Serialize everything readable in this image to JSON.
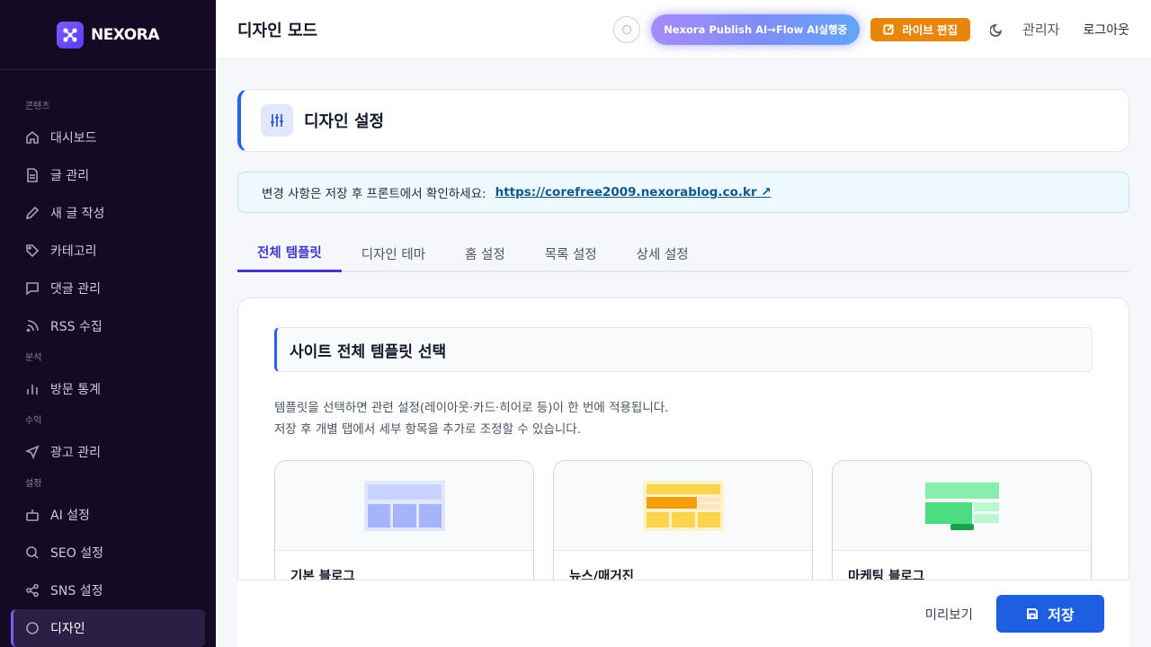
{
  "brand": {
    "name": "NEXORA",
    "logo_icon": "network-icon"
  },
  "sidebar": {
    "sections": [
      {
        "label": "콘텐츠",
        "items": [
          {
            "label": "대시보드",
            "icon": "home-icon"
          },
          {
            "label": "글 관리",
            "icon": "file-icon"
          },
          {
            "label": "새 글 작성",
            "icon": "pencil-icon"
          },
          {
            "label": "카테고리",
            "icon": "tag-icon"
          },
          {
            "label": "댓글 관리",
            "icon": "comment-icon"
          },
          {
            "label": "RSS 수집",
            "icon": "rss-icon"
          }
        ]
      },
      {
        "label": "분석",
        "items": [
          {
            "label": "방문 통계",
            "icon": "bar-chart-icon"
          }
        ]
      },
      {
        "label": "수익",
        "items": [
          {
            "label": "광고 관리",
            "icon": "send-icon"
          }
        ]
      },
      {
        "label": "설정",
        "items": [
          {
            "label": "AI 설정",
            "icon": "robot-icon"
          },
          {
            "label": "SEO 설정",
            "icon": "search-icon"
          },
          {
            "label": "SNS 설정",
            "icon": "share-icon"
          },
          {
            "label": "디자인",
            "icon": "palette-icon"
          }
        ]
      }
    ]
  },
  "header": {
    "title": "디자인 모드",
    "ai_pill": "Nexora Publish AI→Flow AI실행중",
    "live_edit": "라이브 편집",
    "admin": "관리자",
    "logout": "로그아웃"
  },
  "settings_card": {
    "title": "디자인 설정"
  },
  "notice": {
    "text": "변경 사항은 저장 후 프론트에서 확인하세요:",
    "link": "https://corefree2009.nexorablog.co.kr ↗"
  },
  "tabs": [
    {
      "label": "전체 템플릿",
      "active": true
    },
    {
      "label": "디자인 테마",
      "active": false
    },
    {
      "label": "홈 설정",
      "active": false
    },
    {
      "label": "목록 설정",
      "active": false
    },
    {
      "label": "상세 설정",
      "active": false
    }
  ],
  "panel": {
    "title": "사이트 전체 템플릿 선택",
    "desc_line1": "템플릿을 선택하면 관련 설정(레이아웃·카드·히어로 등)이 한 번에 적용됩니다.",
    "desc_line2": "저장 후 개별 탭에서 세부 항목을 추가로 조정할 수 있습니다.",
    "templates": [
      {
        "name": "기본 블로그",
        "colors": [
          "#c7d2fe",
          "#a5b4fc"
        ]
      },
      {
        "name": "뉴스/매거진",
        "colors": [
          "#fcd34d",
          "#f59e0b",
          "#fde2c4"
        ]
      },
      {
        "name": "마케팅 블로그",
        "colors": [
          "#86efac",
          "#4ade80",
          "#bbf7d0",
          "#16a34a"
        ]
      }
    ]
  },
  "footer": {
    "preview": "미리보기",
    "save": "저장"
  }
}
